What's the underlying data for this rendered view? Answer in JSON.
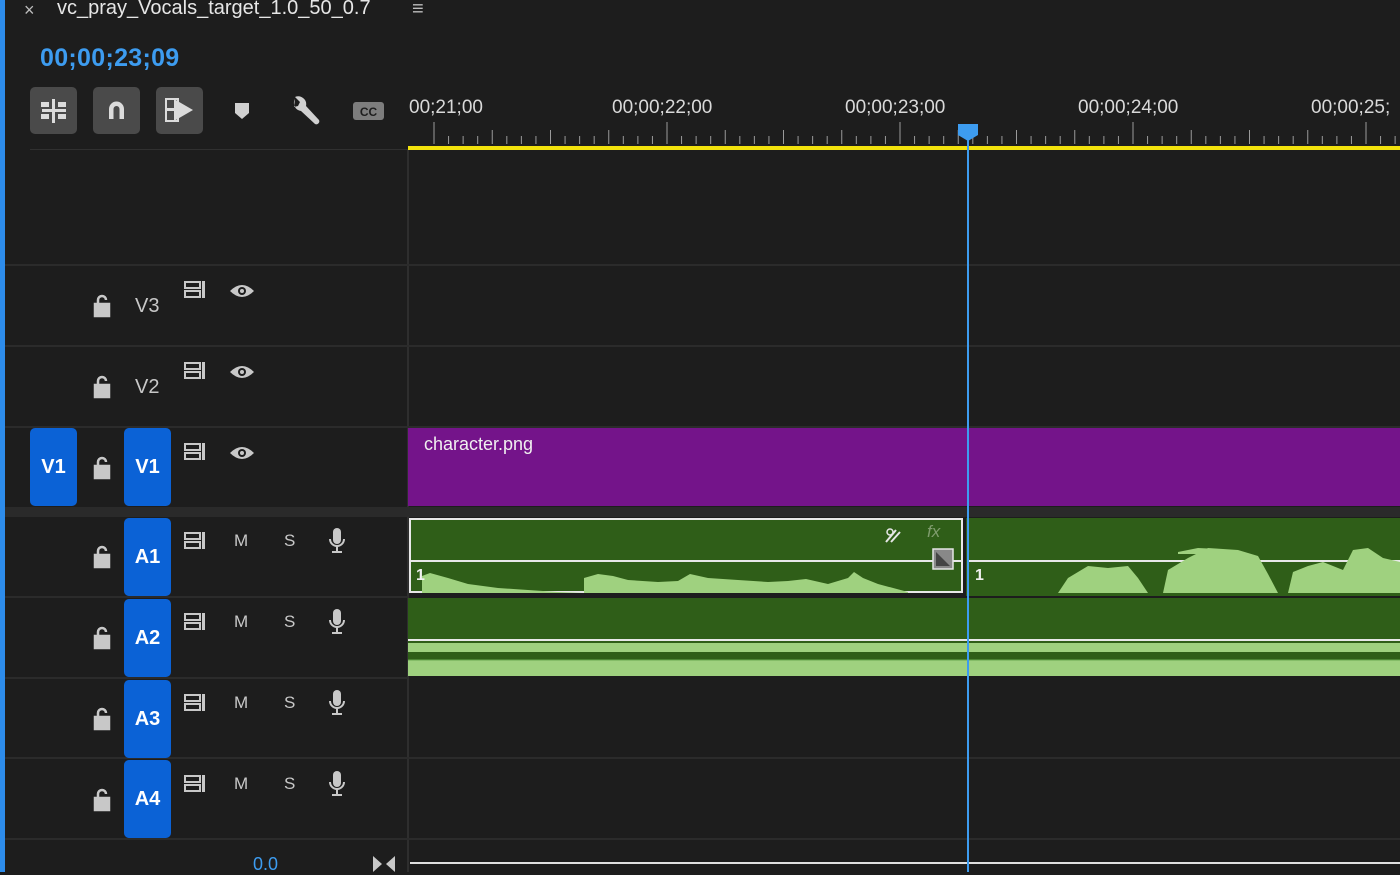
{
  "sequence": {
    "tab_close": "×",
    "title": "vc_pray_Vocals_target_1.0_50_0.7",
    "menu_glyph": "≡",
    "timecode": "00;00;23;09"
  },
  "ruler": {
    "labels": [
      "00;21;00",
      "00;00;22;00",
      "00;00;23;00",
      "00;00;24;00",
      "00;00;25;"
    ]
  },
  "tracks": {
    "v3": {
      "label": "V3"
    },
    "v2": {
      "label": "V2"
    },
    "v1": {
      "source": "V1",
      "label": "V1"
    },
    "a1": {
      "label": "A1",
      "mute": "M",
      "solo": "S"
    },
    "a2": {
      "label": "A2",
      "mute": "M",
      "solo": "S"
    },
    "a3": {
      "label": "A3",
      "mute": "M",
      "solo": "S"
    },
    "a4": {
      "label": "A4",
      "mute": "M",
      "solo": "S"
    }
  },
  "clips": {
    "v1_name": "character.png",
    "a1_left_channel": "1",
    "a1_right_channel": "1",
    "fx_badge": "fx"
  },
  "master": {
    "volume": "0.0"
  },
  "colors": {
    "accent": "#3d9cf0",
    "track_target": "#0b62d6",
    "video_clip": "#74148a",
    "audio_clip": "#2f5e18",
    "waveform": "#9fd17f",
    "work_area": "#f2e20c"
  },
  "icons": [
    "insert-edit-icon",
    "snap-magnet-icon",
    "linked-selection-icon",
    "add-marker-icon",
    "wrench-icon",
    "captions-icon",
    "lock-icon",
    "sync-lock-icon",
    "eye-icon",
    "mic-icon"
  ]
}
